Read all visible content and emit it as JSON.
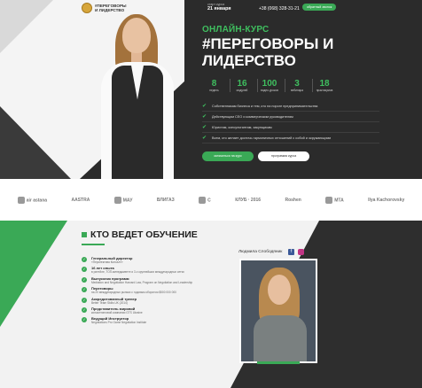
{
  "brand": {
    "name": "#ПЕРЕГОВОРЫ И ЛИДЕРСТВО"
  },
  "header": {
    "date_label": "старт курса",
    "date_value": "21 января",
    "phone": "+38 (068) 328-31-21",
    "callback_label": "обратный звонок"
  },
  "hero": {
    "subtitle": "ОНЛАЙН-КУРС",
    "title": "#ПЕРЕГОВОРЫ И ЛИДЕРСТВО",
    "stats": [
      {
        "value": "8",
        "label": "недель"
      },
      {
        "value": "16",
        "label": "модулей"
      },
      {
        "value": "100",
        "label": "видео-уроков"
      },
      {
        "value": "3",
        "label": "вебинара"
      },
      {
        "value": "18",
        "label": "практикумов"
      }
    ],
    "audience": [
      "Собственникам бизнеса и тем, кто на пороге предпринимательства",
      "Действующим CEO и коммерческим руководителям",
      "Юристам, консультантам, закупщикам",
      "Всем, кто желает достичь гармоничных отношений с собой и окружающими"
    ],
    "join_label": "записаться на курс",
    "program_label": "программа курса"
  },
  "partners": [
    "air astana",
    "AASTRA",
    "МАУ",
    "ВЛИГАЗ",
    "С",
    "КЛУБ · 2016",
    "Roshen",
    "MTA",
    "Ilya Kachorovsky"
  ],
  "teacher_section": {
    "title": "КТО ВЕДЕТ ОБУЧЕНИЕ",
    "teacher_name": "Людмила Слободяник",
    "credentials": [
      {
        "title": "Генеральный директор",
        "desc": "«Перспектива Консалт»"
      },
      {
        "title": "16 лет опыта",
        "desc": "в ритейле, ТОП-менеджменте и 3-х крупнейших международных сетях"
      },
      {
        "title": "Выпускник программ",
        "desc": "Mediation and Negotiation Harvard Law, Program on Negotiation and Leadership"
      },
      {
        "title": "Переговоры",
        "desc": "на 20 международных рынках с годовым оборотом $500 000 000"
      },
      {
        "title": "Аккредитованный тренер",
        "desc": "Better Team Skills UK (2014)"
      },
      {
        "title": "Представитель мировой",
        "desc": "консалтинговой компании GTS Ukraine"
      },
      {
        "title": "Ведущий Инструктор",
        "desc": "Negotiations Pro Game Negotiation Institute"
      }
    ]
  },
  "colors": {
    "accent": "#3aa956",
    "dark": "#2b2b2b"
  }
}
